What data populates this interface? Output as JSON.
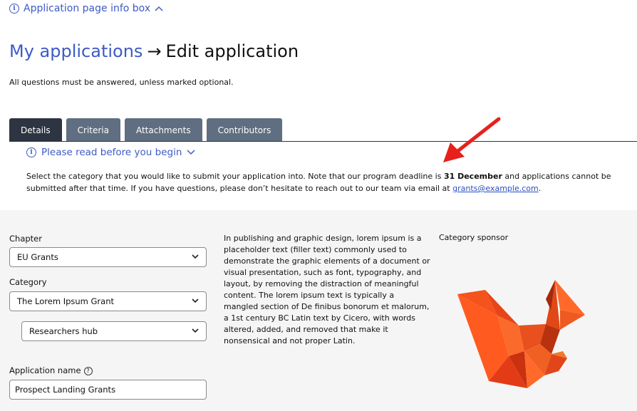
{
  "info_box": {
    "label": "Application page info box"
  },
  "header": {
    "breadcrumb": "My applications",
    "arrow": "→",
    "title": "Edit application"
  },
  "subtitle": "All questions must be answered, unless marked optional.",
  "tabs": [
    {
      "label": "Details",
      "active": true
    },
    {
      "label": "Criteria",
      "active": false
    },
    {
      "label": "Attachments",
      "active": false
    },
    {
      "label": "Contributors",
      "active": false
    }
  ],
  "notice": {
    "heading": "Please read before you begin",
    "text_before": "Select the category that you would like to submit your application into. Note that our program deadline is ",
    "deadline": "31 December",
    "text_after": " and applications cannot be submitted after that time. If you have questions, please don’t hesitate to reach out to our team via email at ",
    "email": "grants@example.com",
    "text_end": "."
  },
  "form": {
    "chapter": {
      "label": "Chapter",
      "value": "EU Grants"
    },
    "category": {
      "label": "Category",
      "value": "The Lorem Ipsum Grant"
    },
    "subcategory": {
      "value": "Researchers hub"
    },
    "application_name": {
      "label": "Application name",
      "value": "Prospect Landing Grants"
    }
  },
  "description": "In publishing and graphic design, lorem ipsum is a placeholder text (filler text) commonly used to demonstrate the graphic elements of a document or visual presentation, such as font, typography, and layout, by removing the distraction of meaningful content. The lorem ipsum text is typically a mangled section of De finibus bonorum et malorum, a 1st century BC Latin text by Cicero, with words altered, added, and removed that make it nonsensical and not proper Latin.",
  "sponsor": {
    "label": "Category sponsor",
    "logo": "origami-squirrel-logo"
  },
  "colors": {
    "link": "#3d5bc4",
    "tab_active": "#2d3442",
    "tab_inactive": "#5f6e80",
    "annotation_arrow": "#e8201c"
  }
}
